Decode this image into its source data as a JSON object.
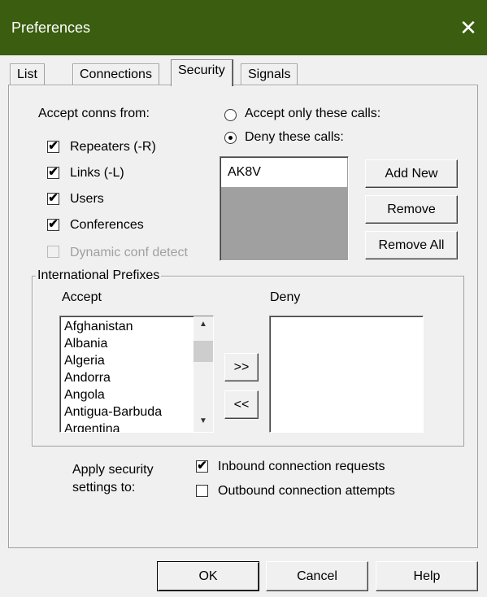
{
  "window": {
    "title": "Preferences",
    "close_glyph": "✕"
  },
  "tabs": [
    {
      "label": "List",
      "active": false
    },
    {
      "label": "Connections",
      "active": false
    },
    {
      "label": "Security",
      "active": true
    },
    {
      "label": "Signals",
      "active": false
    }
  ],
  "accept_conns": {
    "label": "Accept conns from:",
    "items": [
      {
        "label": "Repeaters (-R)",
        "checked": true,
        "enabled": true
      },
      {
        "label": "Links (-L)",
        "checked": true,
        "enabled": true
      },
      {
        "label": "Users",
        "checked": true,
        "enabled": true
      },
      {
        "label": "Conferences",
        "checked": true,
        "enabled": true
      },
      {
        "label": "Dynamic conf detect",
        "checked": false,
        "enabled": false
      }
    ]
  },
  "call_filter": {
    "accept_only_label": "Accept only these calls:",
    "deny_label": "Deny these calls:",
    "selected": "deny",
    "calls": [
      "AK8V"
    ],
    "add_new_label": "Add New",
    "remove_label": "Remove",
    "remove_all_label": "Remove All"
  },
  "international_prefixes": {
    "title": "International Prefixes",
    "accept_label": "Accept",
    "deny_label": "Deny",
    "accept_list": [
      "Afghanistan",
      "Albania",
      "Algeria",
      "Andorra",
      "Angola",
      "Antigua-Barbuda",
      "Argentina"
    ],
    "deny_list": [],
    "move_right_label": ">>",
    "move_left_label": "<<",
    "scroll_up_glyph": "▲",
    "scroll_down_glyph": "▼"
  },
  "apply_security": {
    "label_line1": "Apply security",
    "label_line2": "settings to:",
    "inbound_label": "Inbound connection requests",
    "inbound_checked": true,
    "outbound_label": "Outbound connection attempts",
    "outbound_checked": false
  },
  "footer": {
    "ok_label": "OK",
    "cancel_label": "Cancel",
    "help_label": "Help"
  },
  "check_glyph": "✔",
  "colors": {
    "titlebar": "#3a5d0f",
    "listbox_empty": "#a0a0a0"
  }
}
